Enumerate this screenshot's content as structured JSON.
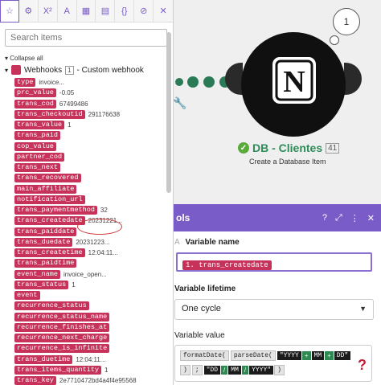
{
  "canvas": {
    "bubble_count": "1",
    "module": {
      "title": "DB - Clientes",
      "number": "41",
      "subtitle": "Create a Database Item",
      "logo_letter": "N"
    }
  },
  "variable_panel": {
    "header_title": "ols",
    "variable_name_label": "Variable name",
    "variable_name_prefix": "A",
    "variable_name_value": "1. trans_createdate",
    "lifetime_label": "Variable lifetime",
    "lifetime_value": "One cycle",
    "value_label": "Variable value",
    "value_row1": {
      "fn1": "formatDate(",
      "fn2": "parseDate(",
      "lit1": "\"YYYY",
      "sep1": "+",
      "lit2": "MM",
      "sep2": "+",
      "lit3": "DD\""
    },
    "value_row2": {
      "c1": ")",
      "c2": ";",
      "lit1": "\"DD",
      "sep1": "/",
      "lit2": "MM",
      "sep2": "/",
      "lit3": "YYYY\"",
      "c3": ")"
    },
    "annotation_qmark": "?"
  },
  "left_panel": {
    "toolbar_icons": [
      "star-icon",
      "settings-icon",
      "superscript-icon",
      "text-icon",
      "calendar-icon",
      "table-icon",
      "braces-icon",
      "tag-icon",
      "close-icon"
    ],
    "toolbar_glyphs": [
      "☆",
      "⚙",
      "X²",
      "A",
      "▦",
      "▤",
      "{}",
      "⊘",
      "✕"
    ],
    "search_placeholder": "Search items",
    "collapse_label": "Collapse all",
    "webhook": {
      "name": "Webhooks",
      "badge": "1",
      "subtitle": "- Custom webhook"
    },
    "items": [
      {
        "name": "type",
        "value": "invoice..."
      },
      {
        "name": "prc_value",
        "value": "-0.05"
      },
      {
        "name": "trans_cod",
        "value": "67499486"
      },
      {
        "name": "trans_checkoutid",
        "value": "291176638"
      },
      {
        "name": "trans_value",
        "value": "1"
      },
      {
        "name": "trans_paid",
        "value": ""
      },
      {
        "name": "cop_value",
        "value": ""
      },
      {
        "name": "partner_cod",
        "value": ""
      },
      {
        "name": "trans_next",
        "value": ""
      },
      {
        "name": "trans_recovered",
        "value": ""
      },
      {
        "name": "main_affiliate",
        "value": ""
      },
      {
        "name": "notification_url",
        "value": ""
      },
      {
        "name": "trans_paymentmethod",
        "value": "32"
      },
      {
        "name": "trans_createdate",
        "value": "20231221..."
      },
      {
        "name": "trans_paiddate",
        "value": ""
      },
      {
        "name": "trans_duedate",
        "value": "20231223..."
      },
      {
        "name": "trans_createtime",
        "value": "12:04:11..."
      },
      {
        "name": "trans_paidtime",
        "value": ""
      },
      {
        "name": "event_name",
        "value": "invoice_open..."
      },
      {
        "name": "trans_status",
        "value": "1"
      },
      {
        "name": "event",
        "value": ""
      },
      {
        "name": "recurrence_status",
        "value": ""
      },
      {
        "name": "recurrence_status_name",
        "value": ""
      },
      {
        "name": "recurrence_finishes_at",
        "value": ""
      },
      {
        "name": "recurrence_next_charge",
        "value": ""
      },
      {
        "name": "recurrence_is_infinite",
        "value": ""
      },
      {
        "name": "trans_duetime",
        "value": "12:04:11..."
      },
      {
        "name": "trans_items_quantity",
        "value": "1"
      },
      {
        "name": "trans_key",
        "value": "2e7710472bd4a4f4e955687..."
      }
    ]
  },
  "colors": {
    "accent_purple": "#7a5cc8",
    "pill_red": "#c7325a",
    "module_green": "#2d8c5a"
  }
}
